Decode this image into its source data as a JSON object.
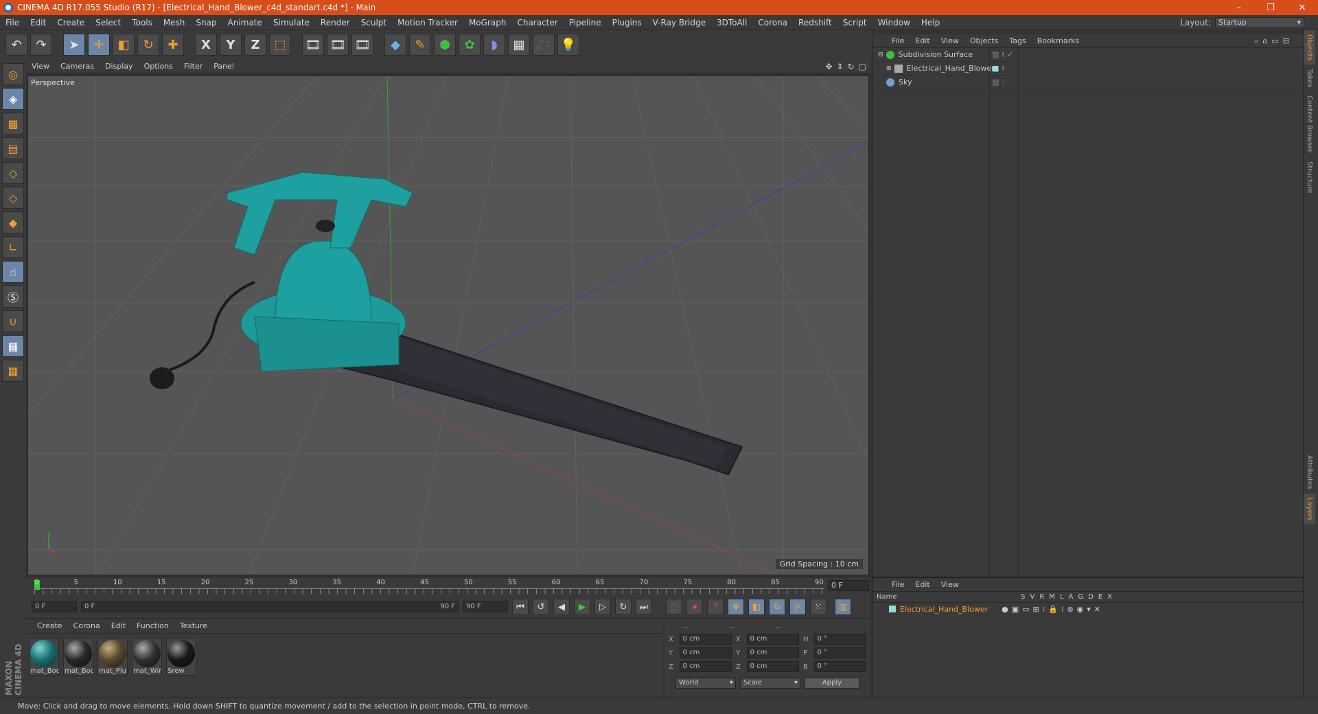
{
  "window": {
    "title": "CINEMA 4D R17.055 Studio (R17) - [Electrical_Hand_Blower_c4d_standart.c4d *] - Main",
    "controls": [
      "–",
      "❐",
      "✕"
    ]
  },
  "menubar": {
    "items": [
      "File",
      "Edit",
      "Create",
      "Select",
      "Tools",
      "Mesh",
      "Snap",
      "Animate",
      "Simulate",
      "Render",
      "Sculpt",
      "Motion Tracker",
      "MoGraph",
      "Character",
      "Pipeline",
      "Plugins",
      "V-Ray Bridge",
      "3DToAll",
      "Corona",
      "Redshift",
      "Script",
      "Window",
      "Help"
    ],
    "layout_label": "Layout:",
    "layout_value": "Startup"
  },
  "toolbar": {
    "undo_icon": "undo-icon",
    "axis_x": "X",
    "axis_y": "Y",
    "axis_z": "Z"
  },
  "viewport": {
    "menu": [
      "View",
      "Cameras",
      "Display",
      "Options",
      "Filter",
      "Panel"
    ],
    "label": "Perspective",
    "grid_spacing": "Grid Spacing : 10 cm",
    "colors": {
      "model": "#1e9a9a",
      "background": "#555555",
      "grid": "#606060"
    }
  },
  "timeline": {
    "ticks": [
      "0",
      "5",
      "10",
      "15",
      "20",
      "25",
      "30",
      "35",
      "40",
      "45",
      "50",
      "55",
      "60",
      "65",
      "70",
      "75",
      "80",
      "85",
      "90"
    ],
    "current_frame": "0 F"
  },
  "playbar": {
    "start": "0 F",
    "range_start": "0 F",
    "range_end": "90 F",
    "end": "90 F"
  },
  "materials": {
    "menu": [
      "Create",
      "Corona",
      "Edit",
      "Function",
      "Texture"
    ],
    "items": [
      {
        "name": "mat_Boc",
        "color": "#1b6f70"
      },
      {
        "name": "mat_Boc",
        "color": "#2a2a2a"
      },
      {
        "name": "mat_Plu",
        "color": "#5a4a30"
      },
      {
        "name": "mat_Wir",
        "color": "#333333"
      },
      {
        "name": "Srew",
        "color": "#1a1a1a"
      }
    ]
  },
  "coords": {
    "dashes": [
      "--",
      "--",
      "--"
    ],
    "rows": [
      {
        "a": "X",
        "av": "0 cm",
        "b": "X",
        "bv": "0 cm",
        "c": "H",
        "cv": "0 °"
      },
      {
        "a": "Y",
        "av": "0 cm",
        "b": "Y",
        "bv": "0 cm",
        "c": "P",
        "cv": "0 °"
      },
      {
        "a": "Z",
        "av": "0 cm",
        "b": "Z",
        "bv": "0 cm",
        "c": "B",
        "cv": "0 °"
      }
    ],
    "mode": "World",
    "size_mode": "Scale",
    "apply": "Apply"
  },
  "object_manager": {
    "menu": [
      "File",
      "Edit",
      "View",
      "Objects",
      "Tags",
      "Bookmarks"
    ],
    "objects": [
      {
        "name": "Subdivision Surface",
        "icon_color": "#40c040"
      },
      {
        "name": "Electrical_Hand_Blower",
        "icon_color": "#aaaaaa"
      },
      {
        "name": "Sky",
        "icon_color": "#7aa0d0"
      }
    ]
  },
  "side_tabs": [
    "Objects",
    "Takes",
    "Content Browser",
    "Structure"
  ],
  "side_tabs_bottom": [
    "Attributes",
    "Layers"
  ],
  "layer_manager": {
    "menu": [
      "File",
      "Edit",
      "View"
    ],
    "name_header": "Name",
    "cols": [
      "S",
      "V",
      "R",
      "M",
      "L",
      "A",
      "G",
      "D",
      "E",
      "X"
    ],
    "layers": [
      {
        "name": "Electrical_Hand_Blower"
      }
    ]
  },
  "status": "Move: Click and drag to move elements. Hold down SHIFT to quantize movement / add to the selection in point mode, CTRL to remove.",
  "brand": "MAXON CINEMA 4D"
}
